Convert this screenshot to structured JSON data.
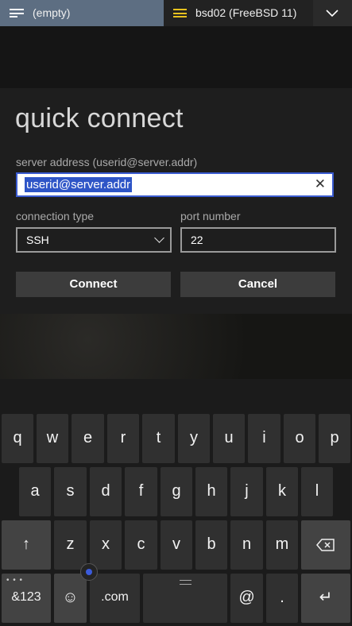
{
  "tabs": [
    {
      "label": "(empty)"
    },
    {
      "label": "bsd02 (FreeBSD 11)"
    }
  ],
  "dropdown_icon": "chevron-down-icon",
  "dialog": {
    "title": "quick connect",
    "server_address_label": "server address (userid@server.addr)",
    "server_address_value": "userid@server.addr",
    "connection_type_label": "connection type",
    "connection_type_value": "SSH",
    "port_number_label": "port number",
    "port_number_value": "22",
    "connect_label": "Connect",
    "cancel_label": "Cancel"
  },
  "keyboard": {
    "row1": [
      "q",
      "w",
      "e",
      "r",
      "t",
      "y",
      "u",
      "i",
      "o",
      "p"
    ],
    "row2": [
      "a",
      "s",
      "d",
      "f",
      "g",
      "h",
      "j",
      "k",
      "l"
    ],
    "row3": [
      "z",
      "x",
      "c",
      "v",
      "b",
      "n",
      "m"
    ],
    "shift": "↑",
    "backspace_icon": "backspace-icon",
    "symbols": "&123",
    "emoji": "☺",
    "dotcom": ".com",
    "at": "@",
    "period": ".",
    "enter": "↵"
  },
  "colors": {
    "accent": "#3a5bd0",
    "selection": "#2e55c7",
    "tab_active": "#5d6e82",
    "tab_hamburger_yellow": "#e8c21e"
  }
}
